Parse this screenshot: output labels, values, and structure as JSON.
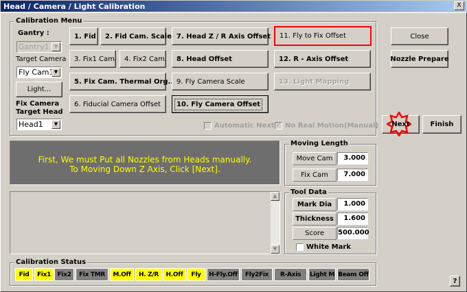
{
  "window": {
    "title": "Head / Camera / Light Calibration",
    "close_glyph": "X"
  },
  "calibration_menu": {
    "label": "Calibration Menu",
    "gantry_label": "Gantry :",
    "gantry_value": "Gantry1",
    "target_camera_label": "Target Camera",
    "target_camera_value": "Fly Cam1",
    "light_button": "Light...",
    "fix_camera_label": "Fix Camera",
    "target_head_label": "Target Head",
    "target_head_value": "Head1",
    "buttons": [
      "1. Fid",
      "2. Fid Cam. Scale",
      "3. Fix1 Cam.",
      "4. Fix2 Cam.",
      "5. Fix Cam. Thermal Org...",
      "6. Fiducial Camera Offset",
      "7. Head Z / R Axis Offset",
      "8. Head Offset",
      "9. Fly Camera Scale",
      "10. Fly Camera Offset",
      "11. Fly to Fix Offset",
      "12. R - Axis Offset",
      "13. Light Mapping"
    ],
    "automatic_next": {
      "label": "Automatic Next",
      "checked": false,
      "enabled": false
    },
    "no_real_motion": {
      "label": "No Real Motion(Manual)",
      "checked": true,
      "enabled": false
    }
  },
  "side_buttons": {
    "close": "Close",
    "nozzle_prepare": "Nozzle Prepare",
    "next": "Next",
    "finish": "Finish"
  },
  "message": {
    "line1": "First, We must Put all Nozzles from Heads manually.",
    "line2": "To Moving Down Z Axis, Click [Next].",
    "text_color": "#ffff00"
  },
  "moving_length": {
    "label": "Moving Length",
    "move_cam_label": "Move Cam",
    "move_cam": "3.000",
    "fix_cam_label": "Fix Cam",
    "fix_cam": "7.000"
  },
  "tool_data": {
    "label": "Tool Data",
    "mark_dia_label": "Mark Dia",
    "mark_dia": "1.000",
    "thickness_label": "Thickness",
    "thickness": "1.600",
    "score_label": "Score",
    "score": "500.000",
    "white_mark_label": "White Mark",
    "white_mark": false
  },
  "calibration_status": {
    "label": "Calibration Status",
    "items": [
      {
        "label": "Fid",
        "done": true
      },
      {
        "label": "Fix1",
        "done": true
      },
      {
        "label": "Fix2",
        "done": false
      },
      {
        "label": "Fix TMR",
        "done": false
      },
      {
        "label": "M.Off",
        "done": true
      },
      {
        "label": "H. Z/R",
        "done": true
      },
      {
        "label": "H.Off",
        "done": true
      },
      {
        "label": "Fly",
        "done": true
      },
      {
        "label": "H-Fly.Off",
        "done": false
      },
      {
        "label": "Fly2Fix",
        "done": false
      },
      {
        "label": "R-Axis",
        "done": false
      },
      {
        "label": "Light M",
        "done": false
      },
      {
        "label": "Beam Off",
        "done": false
      }
    ],
    "done_color": "#ffff00",
    "pending_color": "#808080"
  },
  "help_button": "?"
}
